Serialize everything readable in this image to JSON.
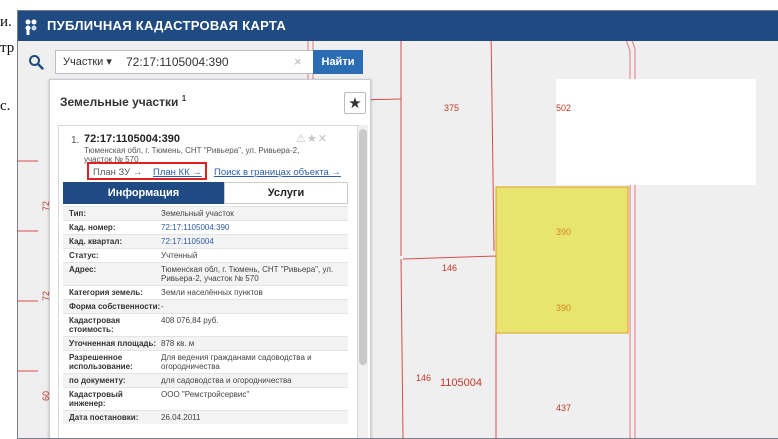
{
  "background_text": {
    "left_fragment_1": "и.",
    "left_fragment_2": "тр",
    "left_fragment_3": "с."
  },
  "app": {
    "title": "ПУБЛИЧНАЯ КАДАСТРОВАЯ КАРТА",
    "logo_icon": "pkk-logo-icon",
    "header_color": "#1f4a82"
  },
  "search": {
    "type": "Участки",
    "value": "72:17:1105004:390",
    "clear_symbol": "×",
    "button_label": "Найти",
    "icon": "search-icon"
  },
  "panel": {
    "title": "Земельные участки",
    "title_sup": "1",
    "favorites_symbol": "★"
  },
  "result": {
    "index": "1.",
    "number": "72:17:1105004:390",
    "address": "Тюменская обл, г. Тюмень, СНТ \"Ривьера\", ул. Ривьера-2, участок № 570",
    "action_icons": "⚠★✕",
    "links": {
      "plan_zu": "План ЗУ →",
      "plan_kk": "План КК →",
      "search_bounds": "Поиск в границах объекта →"
    }
  },
  "tabs": {
    "info": "Информация",
    "services": "Услуги"
  },
  "info_rows": [
    {
      "key": "Тип:",
      "value": "Земельный участок"
    },
    {
      "key": "Кад. номер:",
      "value": "72:17:1105004:390"
    },
    {
      "key": "Кад. квартал:",
      "value": "72:17:1105004"
    },
    {
      "key": "Статус:",
      "value": "Учтенный"
    },
    {
      "key": "Адрес:",
      "value": "Тюменская обл, г. Тюмень, СНТ \"Ривьера\", ул. Ривьера-2, участок № 570"
    },
    {
      "key": "Категория земель:",
      "value": "Земли населённых пунктов"
    },
    {
      "key": "Форма собственности:",
      "value": "-"
    },
    {
      "key": "Кадастровая стоимость:",
      "value": "408 076,84 руб."
    },
    {
      "key": "Уточненная площадь:",
      "value": "878 кв. м"
    },
    {
      "key": "Разрешенное использование:",
      "value": "Для ведения гражданами садоводства и огородничества"
    },
    {
      "key": "по документу:",
      "value": "для садоводства и огородничества"
    },
    {
      "key": "Кадастровый инженер:",
      "value": "ООО \"Ремстройсервис\""
    },
    {
      "key": "Дата постановки:",
      "value": "26.04.2011"
    }
  ],
  "map_labels": {
    "p375": "375",
    "p502": "502",
    "p390_top": "390",
    "p390_bottom": "390",
    "p146_a": "146",
    "p146_b": "146",
    "quarter": "1105004",
    "p437": "437",
    "p72_a": "72",
    "p72_b": "72",
    "p60": "60"
  },
  "colors": {
    "selected_parcel_fill": "#e8e46e",
    "selected_parcel_stroke": "#e0a020",
    "boundary": "#e07070",
    "link": "#2b5ea8",
    "button": "#2b6db5",
    "highlight": "#e02020"
  }
}
